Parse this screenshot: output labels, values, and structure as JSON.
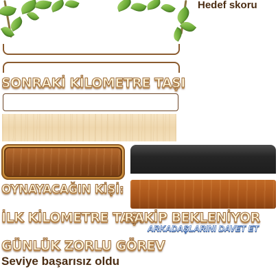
{
  "header": {
    "target_score_label": "Hedef skoru"
  },
  "next_milestone": {
    "title": "SONRAKİ KİLOMETRE TAŞI"
  },
  "opponent": {
    "label": "OYNAYACAĞIN KİŞİ:"
  },
  "first_milestone": {
    "title": "İLK KİLOMETRE TAŞI",
    "awaiting": "RAKİP BEKLENİYOR",
    "invite_friends": "ARKADAŞLARINI DAVET ET"
  },
  "daily_challenge": {
    "title": "GÜNLÜK ZORLU GÖREV",
    "status": "Seviye başarısız oldu"
  },
  "colors": {
    "wood_dark": "#8f4d1d",
    "wood_light": "#efd7ad",
    "panel_dark": "#262626",
    "panel_brown": "#a7541a",
    "invite_blue": "#2b5fb0"
  }
}
